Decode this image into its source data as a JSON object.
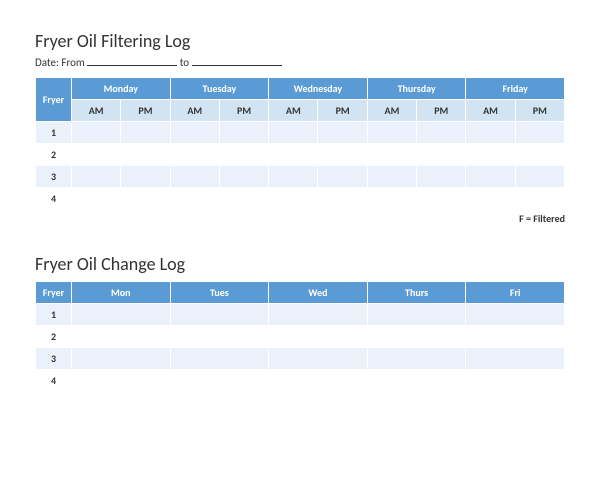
{
  "filtering": {
    "title": "Fryer Oil Filtering Log",
    "date_prefix": "Date: From",
    "date_mid": "to",
    "fryer_header": "Fryer",
    "days": [
      "Monday",
      "Tuesday",
      "Wednesday",
      "Thursday",
      "Friday"
    ],
    "am": "AM",
    "pm": "PM",
    "rows": [
      "1",
      "2",
      "3",
      "4"
    ],
    "legend": "F = Filtered"
  },
  "change": {
    "title": "Fryer Oil Change Log",
    "fryer_header": "Fryer",
    "days": [
      "Mon",
      "Tues",
      "Wed",
      "Thurs",
      "Fri"
    ],
    "rows": [
      "1",
      "2",
      "3",
      "4"
    ]
  }
}
